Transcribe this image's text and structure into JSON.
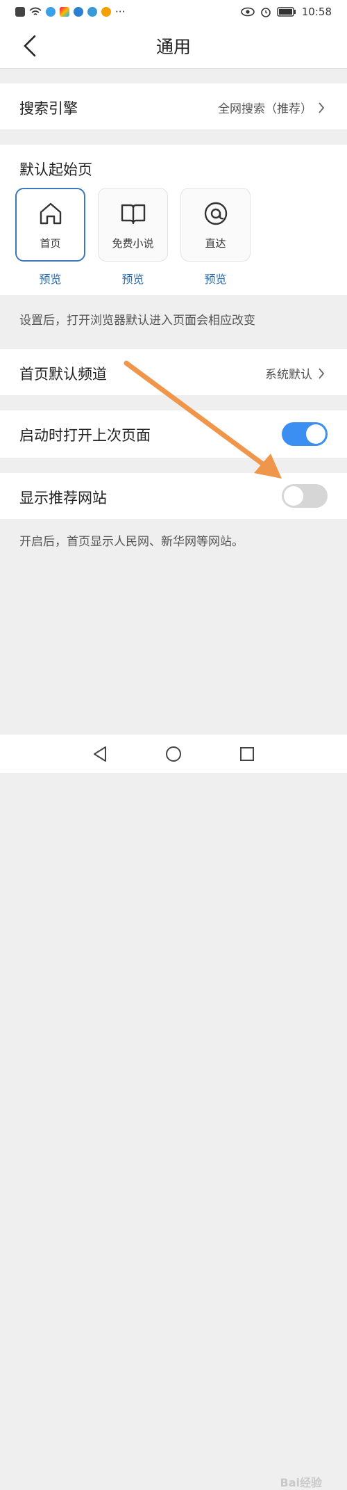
{
  "status_bar": {
    "time": "10:58",
    "dots": "···"
  },
  "header": {
    "title": "通用"
  },
  "search_engine": {
    "label": "搜索引擎",
    "value": "全网搜索（推荐）"
  },
  "default_start": {
    "title": "默认起始页",
    "tiles": [
      {
        "label": "首页",
        "preview": "预览",
        "icon": "home-icon",
        "selected": true
      },
      {
        "label": "免费小说",
        "preview": "预览",
        "icon": "book-icon",
        "selected": false
      },
      {
        "label": "直达",
        "preview": "预览",
        "icon": "at-icon",
        "selected": false
      }
    ],
    "note": "设置后，打开浏览器默认进入页面会相应改变"
  },
  "home_channel": {
    "label": "首页默认频道",
    "value": "系统默认"
  },
  "restore_last": {
    "label": "启动时打开上次页面",
    "enabled": true
  },
  "recommended_sites": {
    "label": "显示推荐网站",
    "enabled": false,
    "note": "开启后，首页显示人民网、新华网等网站。"
  },
  "watermark": "Bai经验",
  "colors": {
    "accent": "#3b8ef2",
    "link": "#2a6bb0",
    "arrow": "#f0964a",
    "selected_border": "#3a78b8"
  }
}
